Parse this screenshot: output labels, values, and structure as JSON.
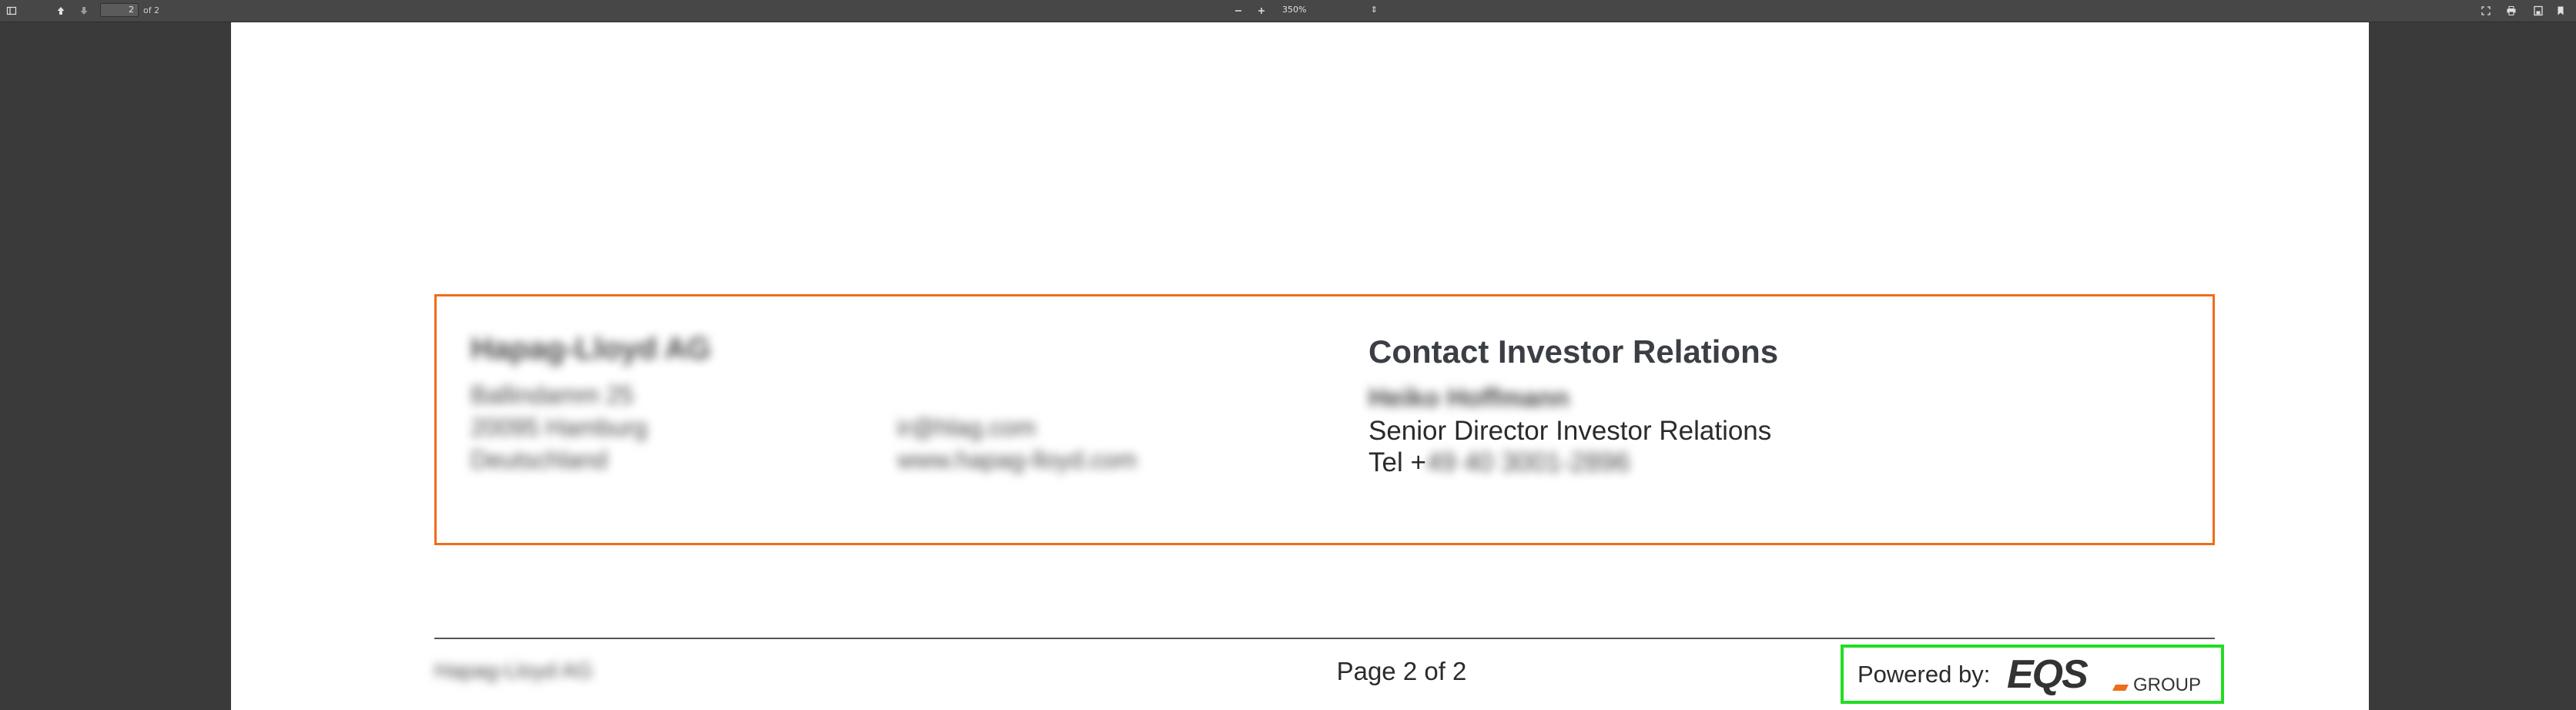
{
  "toolbar": {
    "page_current": "2",
    "page_count": "of 2",
    "zoom": "350%",
    "icons": [
      "sidebar-icon",
      "previous-page-icon",
      "next-page-icon",
      "zoom-out-icon",
      "zoom-in-icon",
      "fullscreen-icon",
      "print-icon",
      "download-icon",
      "bookmark-icon"
    ]
  },
  "document": {
    "company": {
      "name": "Hapag-Lloyd AG",
      "address": [
        "Ballindamm 25",
        "20095 Hamburg",
        "Deutschland"
      ],
      "contact": [
        "ir@hlag.com",
        "www.hapag-lloyd.com"
      ]
    },
    "contact": {
      "title": "Contact Investor Relations",
      "name": "Heiko Hoffmann",
      "role": "Senior Director Investor Relations",
      "tel_prefix": "Tel +",
      "tel_number": "49 40 3001-2896"
    },
    "footer": {
      "company": "Hapag-Lloyd AG",
      "page_label": "Page 2 of 2",
      "powered_by": "Powered by:",
      "logo_main": "EQS",
      "logo_sub": "GROUP"
    }
  },
  "colors": {
    "box_border": "#ef6c1a",
    "highlight": "#22dd22",
    "logo_accent": "#ef6c1a",
    "logo_dark": "#333333"
  }
}
